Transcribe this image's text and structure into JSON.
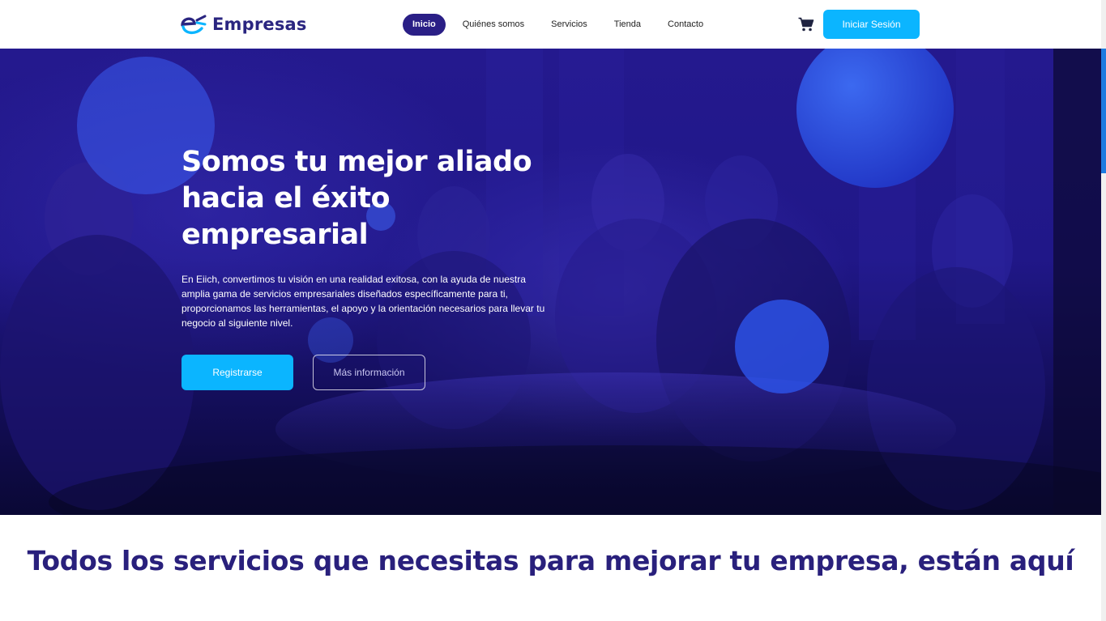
{
  "brand": {
    "logo_icon": "eiich-logo-icon",
    "name": "Empresas",
    "color_primary": "#2a2580",
    "color_accent": "#0bb5ff"
  },
  "nav": {
    "items": [
      {
        "label": "Inicio",
        "active": true
      },
      {
        "label": "Quiénes somos",
        "active": false
      },
      {
        "label": "Servicios",
        "active": false
      },
      {
        "label": "Tienda",
        "active": false
      },
      {
        "label": "Contacto",
        "active": false
      }
    ],
    "cart_icon": "shopping-cart-icon",
    "login_label": "Iniciar Sesión"
  },
  "hero": {
    "title": "Somos tu mejor aliado hacia el éxito empresarial",
    "description": "En Eiich, convertimos tu visión en una realidad exitosa, con la ayuda de nuestra amplia gama de servicios empresariales diseñados específicamente para ti, proporcionamos las herramientas, el apoyo y la orientación necesarios para llevar tu negocio al siguiente nivel.",
    "primary_button": "Registrarse",
    "secondary_button": "Más información",
    "overlay_color": "#24198e"
  },
  "services": {
    "title": "Todos los servicios que necesitas para mejorar tu empresa, están aquí"
  }
}
